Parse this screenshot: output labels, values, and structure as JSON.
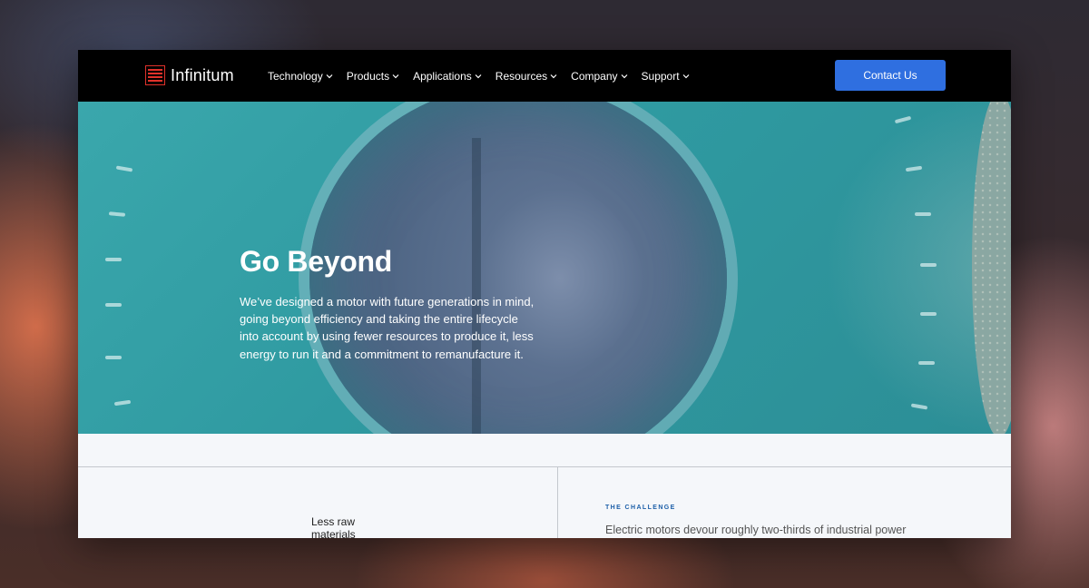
{
  "brand": {
    "name": "Infinitum",
    "logo_icon": "infinitum-logo-icon",
    "logo_color": "#e0312a"
  },
  "nav": {
    "items": [
      {
        "label": "Technology"
      },
      {
        "label": "Products"
      },
      {
        "label": "Applications"
      },
      {
        "label": "Resources"
      },
      {
        "label": "Company"
      },
      {
        "label": "Support"
      }
    ],
    "dropdown_icon": "chevron-down-icon",
    "contact_label": "Contact Us",
    "contact_color": "#2f6fe0"
  },
  "hero": {
    "title": "Go Beyond",
    "body": "We’ve designed a motor with future generations in mind, going beyond efficiency and taking the entire lifecycle into account by using fewer resources to produce it, less energy to run it and a commitment to remanufacture it."
  },
  "section": {
    "left_label": "Less raw materials",
    "challenge_label": "THE CHALLENGE",
    "challenge_text": "Electric motors devour roughly two-thirds of industrial power",
    "accent_color": "#1c5fa8"
  }
}
